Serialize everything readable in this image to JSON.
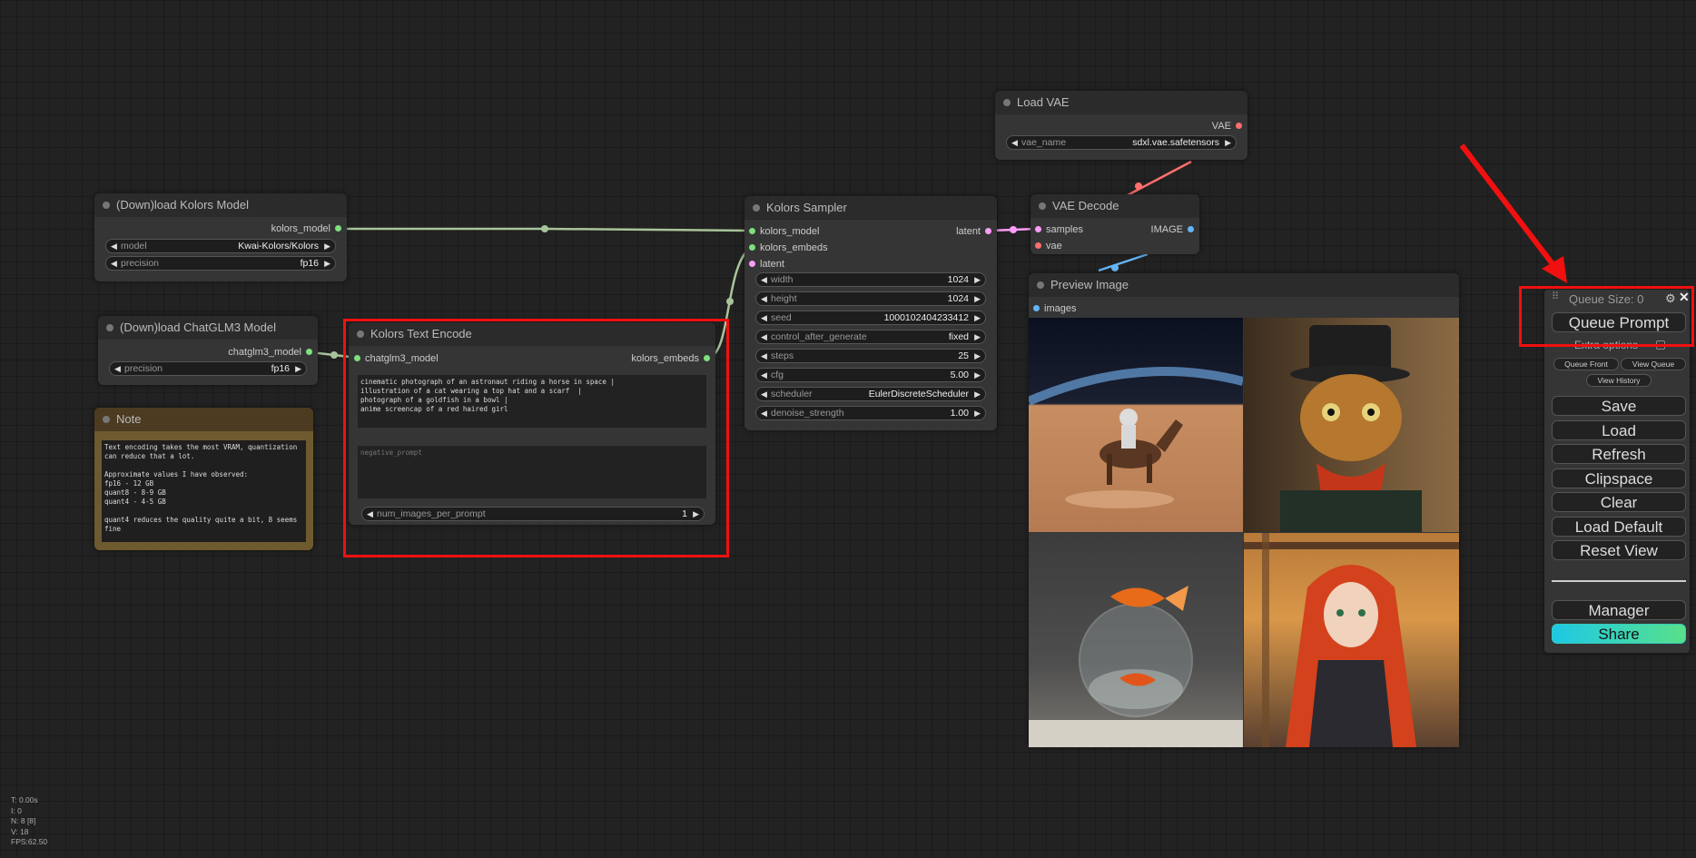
{
  "nodes": {
    "load_kolors": {
      "title": "(Down)load Kolors Model",
      "output": "kolors_model",
      "model_name": "model",
      "model_value": "Kwai-Kolors/Kolors",
      "precision_name": "precision",
      "precision_value": "fp16"
    },
    "load_chatglm": {
      "title": "(Down)load ChatGLM3 Model",
      "output": "chatglm3_model",
      "precision_name": "precision",
      "precision_value": "fp16"
    },
    "note": {
      "title": "Note",
      "text": "Text encoding takes the most VRAM, quantization can reduce that a lot.\n\nApproximate values I have observed:\nfp16 - 12 GB\nquant8 - 8-9 GB\nquant4 - 4-5 GB\n\nquant4 reduces the quality quite a bit, 8 seems fine"
    },
    "text_encode": {
      "title": "Kolors Text Encode",
      "input": "chatglm3_model",
      "output": "kolors_embeds",
      "prompt": "cinematic photograph of an astronaut riding a horse in space |\nillustration of a cat wearing a top hat and a scarf  |\nphotograph of a goldfish in a bowl |\nanime screencap of a red haired girl",
      "negative_placeholder": "negative_prompt",
      "num_images_name": "num_images_per_prompt",
      "num_images_value": "1"
    },
    "sampler": {
      "title": "Kolors Sampler",
      "inputs": [
        "kolors_model",
        "kolors_embeds",
        "latent"
      ],
      "output": "latent",
      "widgets": [
        {
          "name": "width",
          "value": "1024"
        },
        {
          "name": "height",
          "value": "1024"
        },
        {
          "name": "seed",
          "value": "1000102404233412"
        },
        {
          "name": "control_after_generate",
          "value": "fixed"
        },
        {
          "name": "steps",
          "value": "25"
        },
        {
          "name": "cfg",
          "value": "5.00"
        },
        {
          "name": "scheduler",
          "value": "EulerDiscreteScheduler"
        },
        {
          "name": "denoise_strength",
          "value": "1.00"
        }
      ]
    },
    "load_vae": {
      "title": "Load VAE",
      "output": "VAE",
      "vae_name": "vae_name",
      "vae_value": "sdxl.vae.safetensors"
    },
    "vae_decode": {
      "title": "VAE Decode",
      "inputs": [
        "samples",
        "vae"
      ],
      "output": "IMAGE"
    },
    "preview": {
      "title": "Preview Image",
      "input": "images",
      "images": [
        "astronaut riding a horse in space",
        "cat wearing a top hat and scarf",
        "goldfish in a bowl",
        "red haired anime girl"
      ]
    }
  },
  "panel": {
    "queue_size": "Queue Size: 0",
    "queue_prompt": "Queue Prompt",
    "extra_options": "Extra options",
    "queue_front": "Queue Front",
    "view_queue": "View Queue",
    "view_history": "View History",
    "buttons": [
      "Save",
      "Load",
      "Refresh",
      "Clipspace",
      "Clear",
      "Load Default",
      "Reset View"
    ],
    "manager": "Manager",
    "share": "Share"
  },
  "stats": [
    "T: 0.00s",
    "I: 0",
    "N: 8 [8]",
    "V: 18",
    "FPS:62.50"
  ],
  "colors": {
    "highlight": "#f01010",
    "model_slot": "#7ee07e",
    "latent_slot": "#ff9cf9",
    "vae_slot": "#ff6e6e",
    "image_slot": "#64b5f6"
  }
}
